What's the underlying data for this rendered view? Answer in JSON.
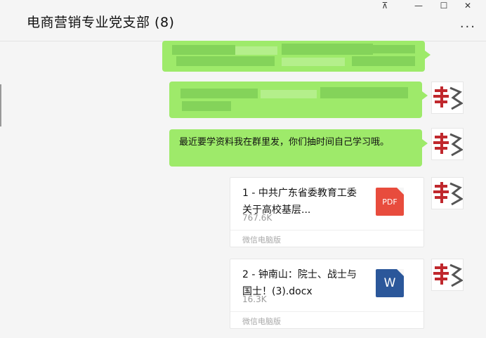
{
  "header": {
    "title": "电商营销专业党支部 (8)",
    "pin_glyph": "⊼",
    "minimize_glyph": "—",
    "maximize_glyph": "☐",
    "close_glyph": "✕",
    "more_glyph": "···"
  },
  "messages": {
    "text_message": "最近要学资料我在群里发，你们抽时间自己学习哦。",
    "files": [
      {
        "name": "1 - 中共广东省委教育工委关于高校基层...",
        "size": "767.6K",
        "icon_label": "PDF",
        "icon_name": "pdf-file-icon",
        "source": "微信电脑版",
        "color": "#e84c3d"
      },
      {
        "name": "2 - 钟南山：院士、战士与国士！(3).docx",
        "size": "16.3K",
        "icon_label": "W",
        "icon_name": "word-file-icon",
        "source": "微信电脑版",
        "color": "#2b579a"
      }
    ]
  },
  "colors": {
    "bubble_green": "#9eea6a",
    "background": "#f5f5f5"
  }
}
